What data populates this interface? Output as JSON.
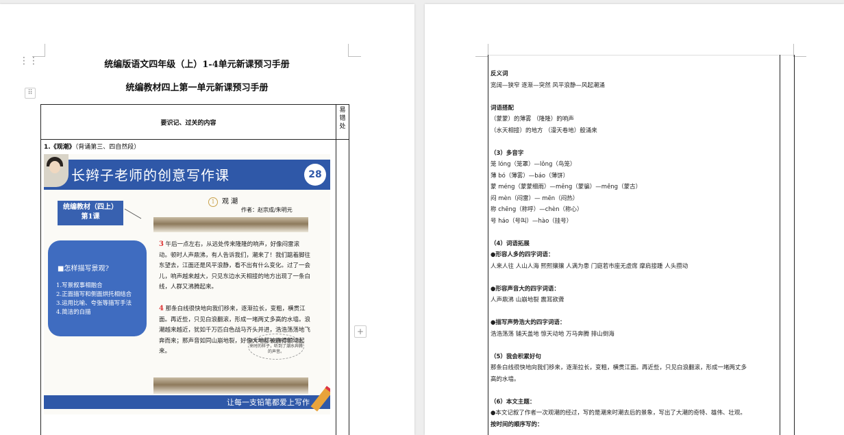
{
  "left_page": {
    "title1": "统编版语文四年级（上）1-4单元新课预习手册",
    "title2": "统编教材四上第一单元新课预习手册",
    "table_header": "要识记、过关的内容",
    "side_header": "易错处",
    "item1": "1.《观潮》",
    "item1_note": "（背诵第三、四自然段）",
    "slide": {
      "banner_title": "长辫子老师的创意写作课",
      "number": "28",
      "label_line1": "统编教材（四上）",
      "label_line2": "第1课",
      "panel_question": "■怎样描写景观?",
      "panel_methods": [
        "1.写景叙事相融合",
        "2.正面描写和侧面烘托相结合",
        "3.运用比喻、夸张等描写手法",
        "4.简洁的白描"
      ],
      "poem_circle": "1",
      "poem_title": "观 潮",
      "author": "作者：赵宗成/朱明元",
      "para3_num": "3",
      "para3_text": "午后一点左右，从远处传来隆隆的响声，好像闷雷滚动。顿时人声鼎沸，有人告诉我们，潮来了！我们踮着脚往东望去，江面还是风平浪静，看不出有什么变化。过了一会儿，响声越来越大，只见东边水天相接的地方出现了一条白线，人群又沸腾起来。",
      "para4_num": "4",
      "para4_text": "那条白线很快地向我们移来，逐渐拉长，变粗，横贯江面。再近些，只见白浪翻滚，形成一堵两丈多高的水墙。浪潮越来越近，犹如千万匹白色战马齐头并进，浩浩荡荡地飞奔而来；那声音如同山崩地裂，好像大地都被震得颤动起来。",
      "bubble_text": "波浪滔滔，很容易看到了潮水来时的样子，听到了潮水奔腾的声音。",
      "footer_text": "让每一支铅笔都爱上写作"
    }
  },
  "right_page": {
    "lines": [
      {
        "t": "反义词",
        "b": true
      },
      {
        "t": "宽阔—狭窄  逐渐—突然  风平浪静—风起潮涌",
        "b": false
      },
      {
        "t": "",
        "b": false
      },
      {
        "t": "词语搭配",
        "b": true
      },
      {
        "t": "（蒙蒙）的薄雾  （隆隆）的响声",
        "b": false
      },
      {
        "t": "（水天相接）的地方  （漫天卷地）般涌来",
        "b": false
      },
      {
        "t": "",
        "b": false
      },
      {
        "t": "（3）多音字",
        "b": true
      },
      {
        "t": "笼 lóng（笼罩）—lǒng（鸟笼）",
        "b": false
      },
      {
        "t": "薄 bó（薄雾）—báo（薄饼）",
        "b": false
      },
      {
        "t": "蒙 méng（蒙蒙细雨）—mēng（蒙骗）—měng（蒙古）",
        "b": false
      },
      {
        "t": "闷 mèn（闷雷）—  mēn（闷热）",
        "b": false
      },
      {
        "t": "称 chēng（称呼）—chèn（称心）",
        "b": false
      },
      {
        "t": "号 háo（号叫）—hào（挂号）",
        "b": false
      },
      {
        "t": "",
        "b": false
      },
      {
        "t": "（4）词语拓展",
        "b": true
      },
      {
        "t": "●形容人多的四字词语：",
        "b": true
      },
      {
        "t": "人来人往  人山人海  熙熙攘攘  人满为患  门庭若市座无虚席  摩肩接踵  人头攒动",
        "b": false
      },
      {
        "t": "",
        "b": false
      },
      {
        "t": "●形容声音大的四字词语：",
        "b": true
      },
      {
        "t": "人声鼎沸  山崩地裂  震耳欲聋",
        "b": false
      },
      {
        "t": "",
        "b": false
      },
      {
        "t": "●描写声势浩大的四字词语：",
        "b": true
      },
      {
        "t": "浩浩荡荡  铺天盖地  惊天动地  万马奔腾  排山倒海",
        "b": false
      },
      {
        "t": "",
        "b": false
      },
      {
        "t": "（5）我会积累好句",
        "b": true
      },
      {
        "t": "那条白线很快地向我们移来，逐渐拉长，变粗，横贯江面。再近些，只见白浪翻滚，形成一堵两丈多",
        "b": false
      },
      {
        "t": "高的水墙。",
        "b": false
      },
      {
        "t": "",
        "b": false
      },
      {
        "t": "（6）本文主题：",
        "b": true
      },
      {
        "t": "●本文记叙了作者一次观潮的经过，写的是潮来时潮去后的景象，写出了大潮的奇特、雄伟、壮观。",
        "b": false
      },
      {
        "t": "按时间的顺序写的：",
        "b": true
      }
    ]
  },
  "add_button": "+"
}
